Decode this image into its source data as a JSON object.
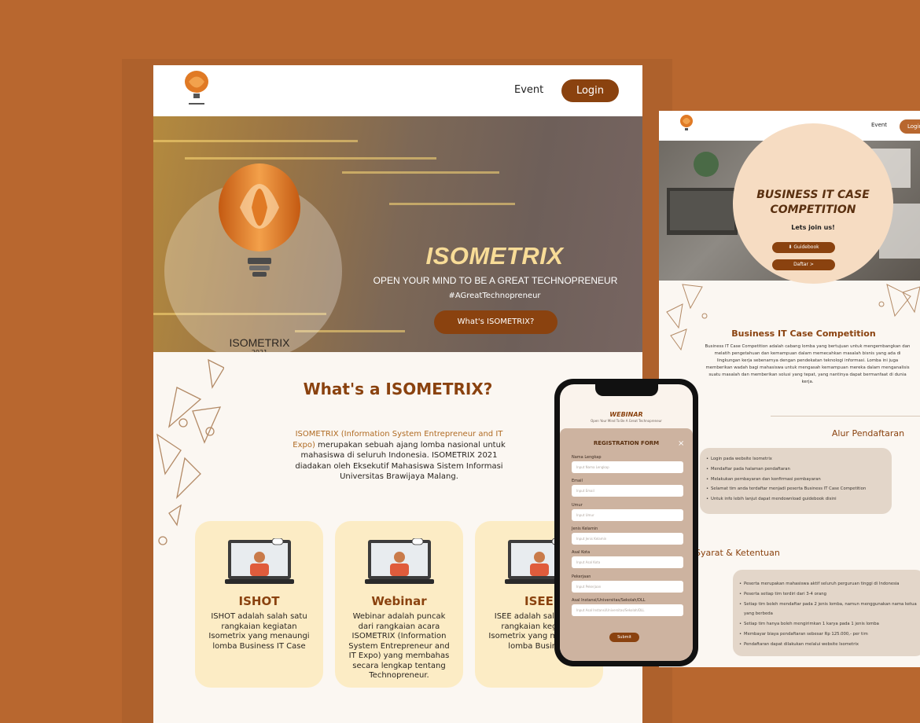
{
  "main": {
    "nav": {
      "event": "Event",
      "login": "Login"
    },
    "hero": {
      "title": "ISOMETRIX",
      "subtitle": "OPEN YOUR MIND TO BE A GREAT TECHNOPRENEUR",
      "tagline": "#AGreatTechnopreneur",
      "cta": "What's ISOMETRIX?",
      "logo_text": "ISOMETRIX",
      "logo_year": "2021"
    },
    "what": {
      "title": "What's a ISOMETRIX?",
      "highlight": "ISOMETRIX (Information System Entrepreneur and IT Expo)",
      "body": "merupakan sebuah ajang lomba nasional untuk mahasiswa di seluruh Indonesia. ISOMETRIX 2021 diadakan oleh Eksekutif Mahasiswa Sistem Informasi Universitas Brawijaya Malang."
    },
    "cards": [
      {
        "title": "ISHOT",
        "desc": "ISHOT adalah salah satu rangkaian kegiatan Isometrix yang menaungi lomba Business IT Case"
      },
      {
        "title": "Webinar",
        "desc": "Webinar adalah puncak dari rangkaian acara ISOMETRIX (Information System Entrepreneur and IT Expo) yang membahas secara lengkap tentang Technopreneur."
      },
      {
        "title": "ISEE",
        "desc": "ISEE adalah salah satu rangkaian kegiatan Isometrix yang menaungi lomba Business"
      }
    ]
  },
  "right": {
    "nav": {
      "event": "Event",
      "login": "Login"
    },
    "hero": {
      "title": "BUSINESS IT CASE COMPETITION",
      "join": "Lets join us!",
      "guidebook": "Guidebook",
      "daftar": "Daftar >"
    },
    "section_title": "Business IT Case Competition",
    "section_desc": "Business IT Case Competition adalah cabang lomba yang bertujuan untuk mengembangkan dan melatih pengetahuan dan kemampuan dalam memecahkan masalah bisnis yang ada di lingkungan kerja sebenarnya dengan pendekatan teknologi informasi. Lomba ini juga memberikan wadah bagi mahasiswa untuk mengasah kemampuan mereka dalam menganalisis suatu masalah dan memberikan solusi yang tepat, yang nantinya dapat bermanfaat di dunia kerja.",
    "alur_title": "Alur Pendaftaran",
    "alur": [
      "Login pada website Isometrix",
      "Mendaftar pada halaman pendaftaran",
      "Melakukan pembayaran dan konfirmasi pembayaran",
      "Selamat tim anda terdaftar menjadi peserta Business IT Case Competition",
      "Untuk info lebih lanjut dapat mendownload guidebook disini"
    ],
    "syarat_title": "Syarat & Ketentuan",
    "syarat": [
      "Peserta merupakan mahasiswa aktif seluruh perguruan tinggi di Indonesia",
      "Peserta setiap tim terdiri dari 3-4 orang",
      "Setiap tim boleh mendaftar pada 2 jenis lomba, namun menggunakan nama ketua yang berbeda",
      "Setiap tim hanya boleh mengirimkan 1 karya pada 1 jenis lomba",
      "Membayar biaya pendaftaran sebesar Rp 125.000,- per tim",
      "Pendaftaran dapat dilakukan melalui website Isometrix"
    ]
  },
  "phone": {
    "page_title": "WEBINAR",
    "page_sub": "Open Your Mind To Be A Great Technopreneur",
    "form_title": "REGISTRATION FORM",
    "close": "×",
    "fields": [
      {
        "label": "Nama Lengkap",
        "placeholder": "Input Nama Lengkap"
      },
      {
        "label": "Email",
        "placeholder": "Input Email"
      },
      {
        "label": "Umur",
        "placeholder": "Input Umur"
      },
      {
        "label": "Jenis Kelamin",
        "placeholder": "Input Jenis Kelamin"
      },
      {
        "label": "Asal Kota",
        "placeholder": "Input Asal Kota"
      },
      {
        "label": "Pekerjaan",
        "placeholder": "Input Pekerjaan"
      },
      {
        "label": "Asal Instansi/Universitas/Sekolah/DLL",
        "placeholder": "Input Asal Instansi/Universitas/Sekolah/DLL"
      }
    ],
    "submit": "Submit"
  },
  "colors": {
    "background": "#b8672f",
    "brand": "#8a420f",
    "card": "#fcecc5",
    "gold": "#f8dc97"
  }
}
